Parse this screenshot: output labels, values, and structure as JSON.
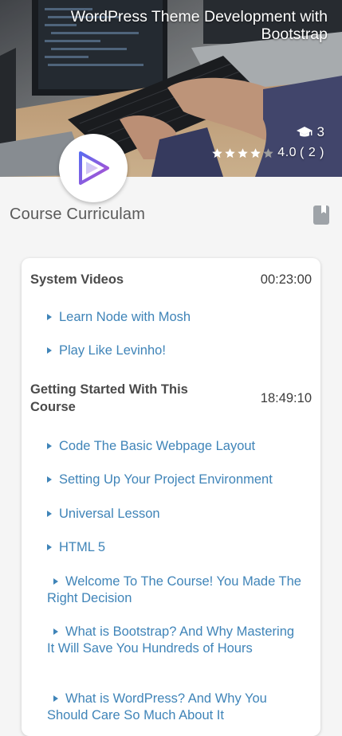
{
  "hero": {
    "title": "WordPress Theme Development with Bootstrap",
    "students_count": "3",
    "rating_value": "4.0",
    "rating_count": "( 2 )",
    "stars_filled": 4,
    "stars_total": 5,
    "icons": {
      "students": "graduation-cap-icon",
      "logo": "play-icon"
    }
  },
  "curriculum": {
    "title": "Course Curriculam",
    "icon": "book-icon",
    "sections": [
      {
        "name": "System Videos",
        "duration": "00:23:00",
        "lessons": [
          "Learn Node with Mosh",
          "Play Like Levinho!"
        ]
      },
      {
        "name": "Getting Started With This Course",
        "duration": "18:49:10",
        "lessons": [
          "Code The Basic Webpage Layout",
          "Setting Up Your Project Environment",
          "Universal Lesson",
          "HTML 5",
          "Welcome To The Course! You Made The Right Decision",
          "What is Bootstrap? And Why Mastering It Will Save You Hundreds of Hours",
          "What is WordPress? And Why You Should Care So Much About It"
        ]
      }
    ]
  },
  "colors": {
    "lesson_link": "#3f84b8",
    "background": "#f5f5f5",
    "star_filled": "#ffffff",
    "star_empty": "#9e9e9e",
    "logo_play": "#7b4fd6"
  }
}
